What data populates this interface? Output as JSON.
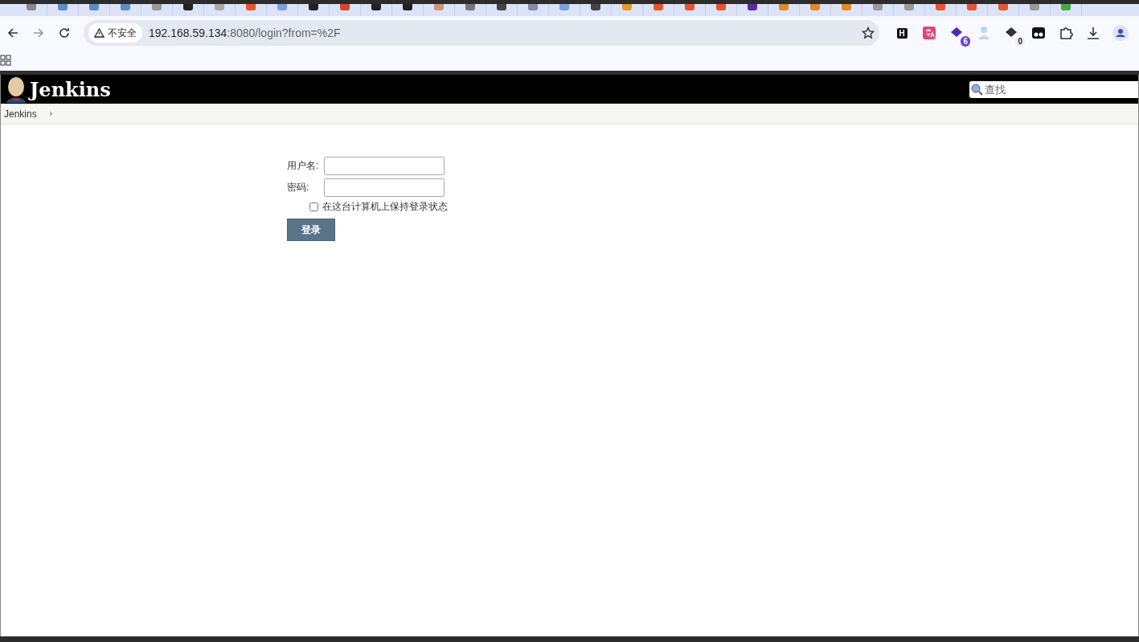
{
  "browser": {
    "security_label": "不安全",
    "url_host": "192.168.59.134",
    "url_rest": ":8080/login?from=%2F",
    "extension_badges": [
      {
        "kind": "letter",
        "text": "H"
      },
      {
        "kind": "translate"
      },
      {
        "kind": "count",
        "text": "6"
      },
      {
        "kind": "figure"
      },
      {
        "kind": "count",
        "text": "0"
      },
      {
        "kind": "mask"
      },
      {
        "kind": "puzzle"
      }
    ]
  },
  "header": {
    "title": "Jenkins",
    "search": {
      "placeholder": "查找"
    }
  },
  "breadcrumb": [
    {
      "label": "Jenkins"
    }
  ],
  "login_form": {
    "username_label": "用户名:",
    "password_label": "密码:",
    "remember": {
      "label": "在这台计算机上保持登录状态",
      "checked": false
    },
    "submit": "登录"
  }
}
